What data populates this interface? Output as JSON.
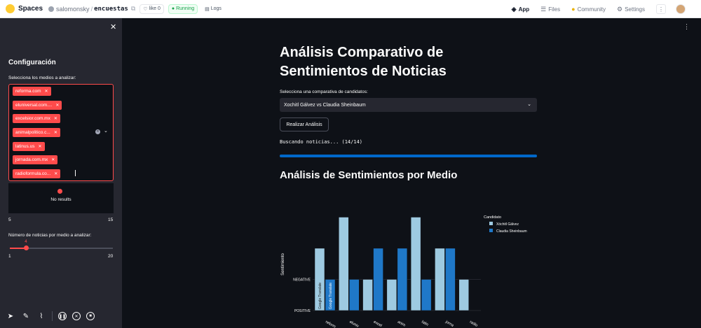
{
  "topbar": {
    "brand": "Spaces",
    "owner": "salomonsky",
    "repo": "encuestas",
    "like_label": "like",
    "like_count": "0",
    "status": "Running",
    "logs_label": "Logs",
    "nav": [
      {
        "label": "App",
        "icon": "app-icon"
      },
      {
        "label": "Files",
        "icon": "files-icon"
      },
      {
        "label": "Community",
        "icon": "community-icon"
      },
      {
        "label": "Settings",
        "icon": "settings-icon"
      }
    ]
  },
  "sidebar": {
    "title": "Configuración",
    "media_label": "Selecciona los medios a analizar:",
    "tags": [
      "reforma.com",
      "eluniversal.com....",
      "excelsior.com.mx",
      "animalpolitico.c...",
      "latinus.us",
      "jornada.com.mx",
      "radioformula.co..."
    ],
    "no_results": "No results",
    "range_min": "5",
    "range_max": "15",
    "news_label": "Número de noticias por medio a analizar:",
    "slider_value": "4",
    "slider_min": "1",
    "slider_max": "20",
    "slider_fraction": 0.158
  },
  "main": {
    "title": "Análisis Comparativo de Sentimientos de Noticias",
    "select_label": "Selecciona una comparativa de candidatos:",
    "select_value": "Xochitl Gálvez vs Claudia Sheinbaum",
    "analyze_button": "Realizar Análisis",
    "status": "Buscando noticias... (14/14)",
    "progress": 1.0,
    "section_title": "Análisis de Sentimientos por Medio"
  },
  "colors": {
    "accent": "#ff4b4b",
    "xochitl": "#9ecae1",
    "claudia": "#1f78c8",
    "progress": "#0068c9"
  },
  "chart_data": {
    "type": "bar",
    "ylabel": "Sentimiento",
    "y_categories": [
      "POSITIVE",
      "NEGATIVE"
    ],
    "legend_title": "Candidato",
    "categories": [
      "reforma.com",
      "eluniversal.com.mx",
      "excelsior.com.mx",
      "animalpolitico.com",
      "latinus.us",
      "jornada.com.mx",
      "radioformula.com.mx"
    ],
    "category_labels_visible": [
      "reform",
      "eluniv",
      "excel",
      "anim",
      "latin",
      "jorna",
      "radio"
    ],
    "series": [
      {
        "name": "Xóchitl Gálvez",
        "values": [
          2,
          3,
          1,
          1,
          3,
          2,
          1
        ]
      },
      {
        "name": "Claudia Sheinbaum",
        "values": [
          1,
          1,
          2,
          2,
          1,
          2,
          0
        ]
      }
    ],
    "bar_texts": [
      {
        "series": 1,
        "index": 0,
        "text": "Google Translate"
      },
      {
        "series": 0,
        "index": 0,
        "text": "Google Translate"
      }
    ],
    "legend_position": "top-right"
  }
}
